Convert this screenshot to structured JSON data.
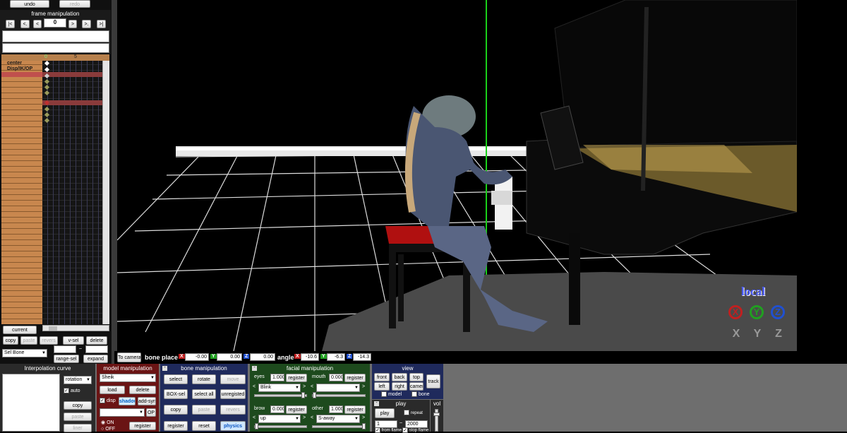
{
  "top": {
    "undo": "undo",
    "redo": "redo"
  },
  "frame_manip": {
    "title": "frame manipulation",
    "nav": [
      "|<",
      "<.",
      "<",
      ">",
      ">.",
      ">|"
    ],
    "frame": "0"
  },
  "timeline": {
    "cols": [
      "0",
      "5"
    ],
    "rows": [
      "center",
      "Disp/IK/OP"
    ],
    "current": "current",
    "copy": "copy",
    "paste": "paste",
    "revers": "revers",
    "vsel": "v-sel",
    "delete": "delete",
    "selbone": "Sel Bone",
    "dash": "~",
    "rangesel": "range-sel",
    "expand": "expand"
  },
  "viewport": {
    "local": "local",
    "axes": [
      "X",
      "Y",
      "Z"
    ],
    "axes2": [
      "X",
      "Y",
      "Z"
    ]
  },
  "bone_place": {
    "tocamera": "To camera",
    "label": "bone place",
    "x": "-0.00",
    "y": "0.00",
    "z": "0.00",
    "angle_label": "angle",
    "ax": "-10.6",
    "ay": "-6.3",
    "az": "-14.3",
    "axis_x": "X",
    "axis_y": "Y",
    "axis_z": "Z"
  },
  "interp": {
    "title": "Interpolation curve",
    "mode": "rotation",
    "auto": "auto",
    "copy": "copy",
    "paste": "paste",
    "liner": "liner"
  },
  "model": {
    "title": "model manipulation",
    "model": "Sheik",
    "load": "load",
    "delete": "delete",
    "disp": "disp",
    "shadow": "shadow",
    "addsyn": "add-syn",
    "op": "OP",
    "on": "ON",
    "off": "OFF",
    "register": "register"
  },
  "bone": {
    "title": "bone manipulation",
    "select": "select",
    "rotate": "rotate",
    "move": "move",
    "boxsel": "BOX-sel",
    "selectall": "select all",
    "unregisted": "unregisted",
    "copy": "copy",
    "paste": "paste",
    "revers": "revers",
    "register": "register",
    "reset": "reset",
    "physics": "physics"
  },
  "facial": {
    "title": "facial manipulation",
    "eyes": "eyes",
    "eyes_val": "1.000",
    "eyes_sel": "Blink",
    "mouth": "mouth",
    "mouth_val": "0.000",
    "mouth_sel": "",
    "brow": "brow",
    "brow_val": "0.000",
    "brow_sel": "up",
    "other": "other",
    "other_val": "1.000",
    "other_sel": "S-away",
    "register": "register",
    "lt": "<",
    "gt": ">"
  },
  "view": {
    "title": "view",
    "front": "front",
    "back": "back",
    "top": "top",
    "track": "track",
    "left": "left",
    "right": "right",
    "camera": "camer",
    "model": "model",
    "bone": "bone"
  },
  "play": {
    "title": "play",
    "play": "play",
    "repeat": "repeat",
    "from": "1",
    "dash": "~",
    "to": "2000",
    "from_frame": "from flame",
    "stop_frame": "stop flame",
    "vol": "vol"
  },
  "colors": {
    "panel_blue": "#1f2a5c",
    "panel_red": "#6a1414",
    "panel_green": "#1d4a1d",
    "timeline_orange": "#c8874e"
  }
}
